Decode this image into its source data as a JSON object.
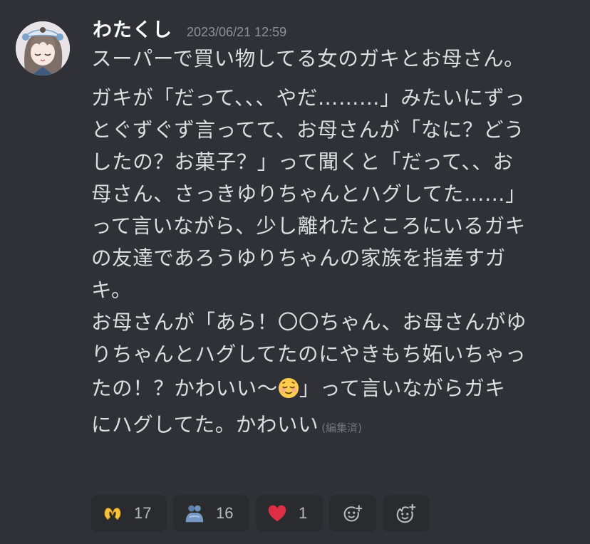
{
  "message": {
    "username": "わたくし",
    "timestamp": "2023/06/21 12:59",
    "lines": [
      "スーパーで買い物してる女のガキとお母さん。",
      "ガキが「だって、、、やだ………」みたいにずっ",
      "とぐずぐず言ってて、お母さんが「なに？どう",
      "したの？お菓子？」って聞くと「だって、、お",
      "母さん、さっきゆりちゃんとハグしてた……」",
      "って言いながら、少し離れたところにいるガキ",
      "の友達であろうゆりちゃんの家族を指差すガ",
      "キ。",
      "お母さんが「あら！〇〇ちゃん、お母さんがゆ",
      "りちゃんとハグしてたのにやきもち妬いちゃっ",
      "たの！？かわいい〜",
      "」って言いながらガキ",
      "にハグしてた。かわいい"
    ],
    "edited_label": "(編集済)",
    "inline_emoji": "relieved-face"
  },
  "reactions": [
    {
      "icon": "heart-hands-icon",
      "count": "17"
    },
    {
      "icon": "people-hugging-icon",
      "count": "16"
    },
    {
      "icon": "red-heart-icon",
      "count": "1"
    },
    {
      "icon": "add-reaction-icon"
    },
    {
      "icon": "add-super-reaction-icon"
    }
  ],
  "colors": {
    "background": "#2f3136",
    "text": "#dcddde",
    "username": "#ffffff",
    "muted": "#8e9297",
    "reaction_bg": "#292b2f"
  }
}
